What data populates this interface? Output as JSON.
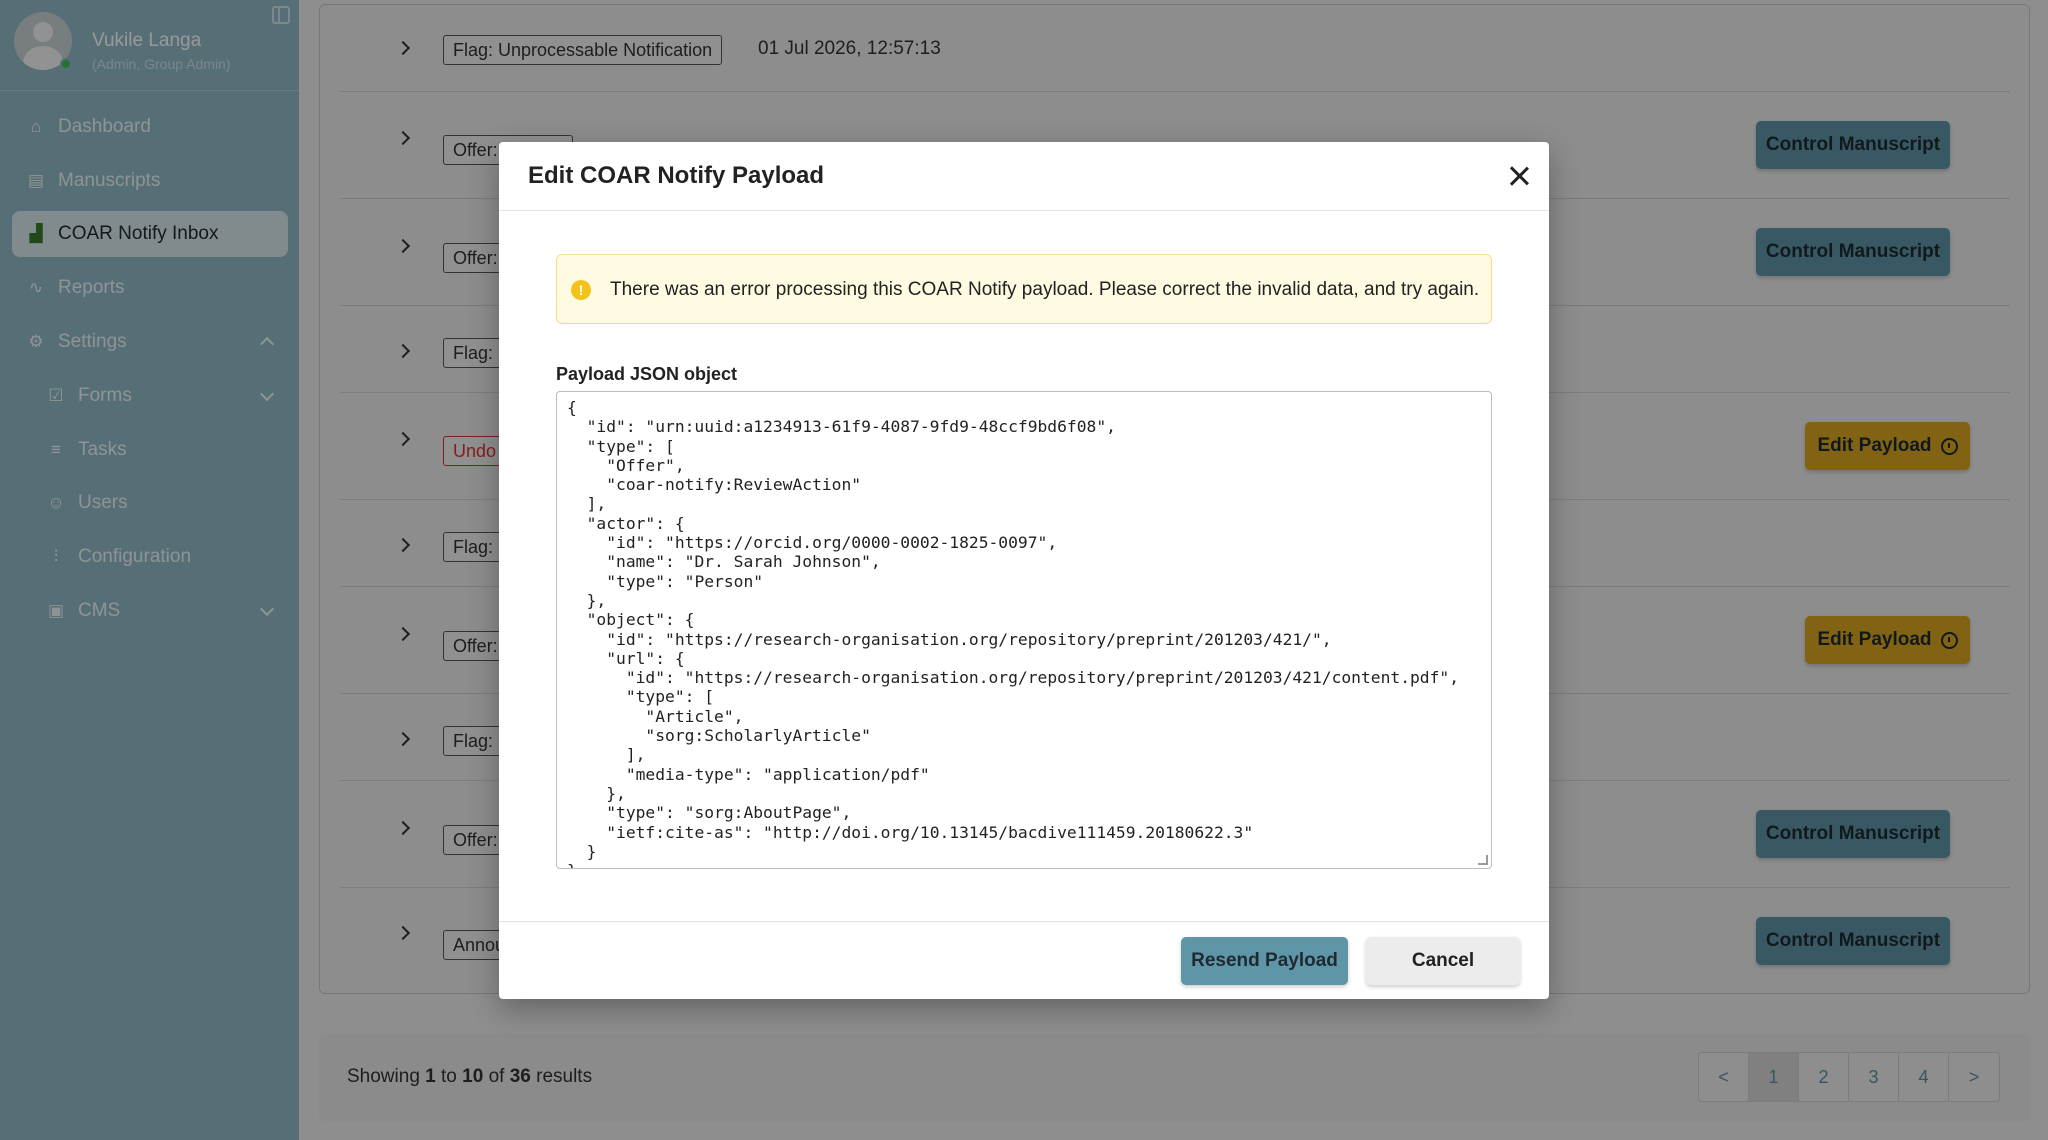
{
  "user": {
    "name": "Vukile Langa",
    "role": "(Admin, Group Admin)"
  },
  "nav": {
    "dashboard": "Dashboard",
    "manuscripts": "Manuscripts",
    "coar_inbox": "COAR Notify Inbox",
    "reports": "Reports",
    "settings": "Settings",
    "forms": "Forms",
    "tasks": "Tasks",
    "users": "Users",
    "configuration": "Configuration",
    "cms": "CMS"
  },
  "rows": [
    {
      "tag": "Flag: Unprocessable Notification",
      "date": "01 Jul 2026, 12:57:13"
    },
    {
      "tag": "Offer: Review",
      "action": "Control Manuscript"
    },
    {
      "tag": "Offer: Review",
      "action": "Control Manuscript"
    },
    {
      "tag": "Flag: Unprocessable Notification"
    },
    {
      "tag": "Undo",
      "action": "Edit Payload"
    },
    {
      "tag": "Flag: Unprocessable Notification"
    },
    {
      "tag": "Offer: Review",
      "action": "Edit Payload"
    },
    {
      "tag": "Flag: Unprocessable Notification"
    },
    {
      "tag": "Offer: Review",
      "action": "Control Manuscript"
    },
    {
      "tag": "Announce: Review",
      "action": "Control Manuscript"
    }
  ],
  "pagination": {
    "showing_prefix": "Showing ",
    "from": "1",
    "to_word": " to ",
    "to": "10",
    "of_word": " of ",
    "total": "36",
    "suffix": " results",
    "prev": "<",
    "pages": [
      "1",
      "2",
      "3",
      "4"
    ],
    "next": ">"
  },
  "modal": {
    "title": "Edit COAR Notify Payload",
    "alert": "There was an error processing this COAR Notify payload. Please correct the invalid data, and try again.",
    "field_label": "Payload JSON object",
    "payload": "{\n  \"id\": \"urn:uuid:a1234913-61f9-4087-9fd9-48ccf9bd6f08\",\n  \"type\": [\n    \"Offer\",\n    \"coar-notify:ReviewAction\"\n  ],\n  \"actor\": {\n    \"id\": \"https://orcid.org/0000-0002-1825-0097\",\n    \"name\": \"Dr. Sarah Johnson\",\n    \"type\": \"Person\"\n  },\n  \"object\": {\n    \"id\": \"https://research-organisation.org/repository/preprint/201203/421/\",\n    \"url\": {\n      \"id\": \"https://research-organisation.org/repository/preprint/201203/421/content.pdf\",\n      \"type\": [\n        \"Article\",\n        \"sorg:ScholarlyArticle\"\n      ],\n      \"media-type\": \"application/pdf\"\n    },\n    \"type\": \"sorg:AboutPage\",\n    \"ietf:cite-as\": \"http://doi.org/10.13145/bacdive111459.20180622.3\"\n  }\n}",
    "resend": "Resend Payload",
    "cancel": "Cancel"
  }
}
